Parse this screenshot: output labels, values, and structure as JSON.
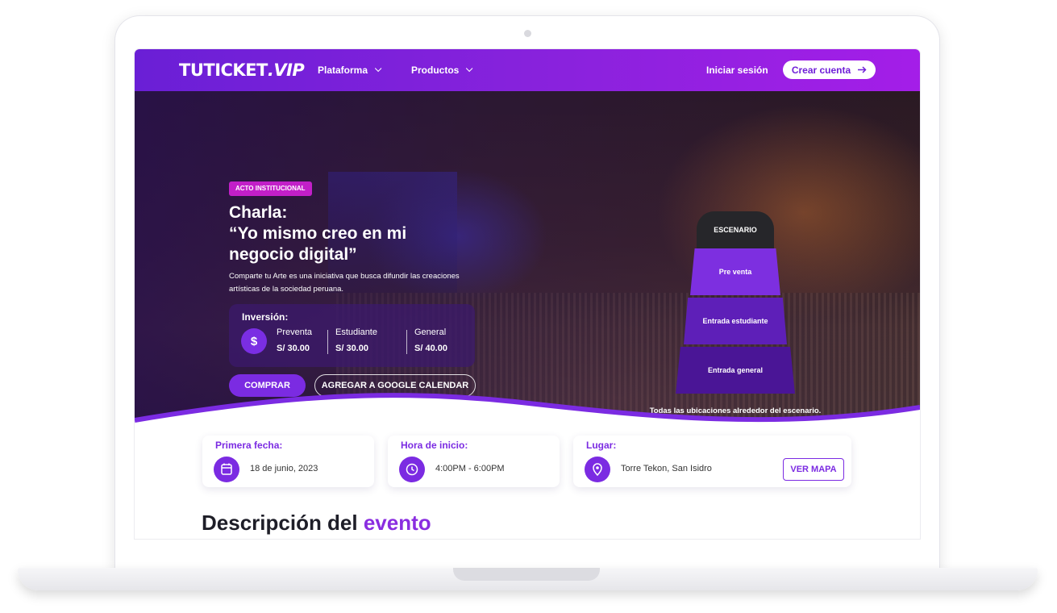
{
  "navbar": {
    "logo_main": "TUTICKET",
    "logo_suffix": ".VIP",
    "platform_label": "Plataforma",
    "products_label": "Productos",
    "login_label": "Iniciar sesión",
    "signup_label": "Crear cuenta"
  },
  "hero": {
    "badge": "ACTO INSTITUCIONAL",
    "title_line1": "Charla:",
    "title_line2": "“Yo mismo creo en mi",
    "title_line3": "negocio digital”",
    "description": "Comparte tu Arte es una iniciativa que busca difundir las creaciones artísticas de la sociedad peruana.",
    "investment": {
      "title": "Inversión:",
      "currency_symbol": "$",
      "prices": [
        {
          "label": "Preventa",
          "value": "S/ 30.00"
        },
        {
          "label": "Estudiante",
          "value": "S/ 30.00"
        },
        {
          "label": "General",
          "value": "S/ 40.00"
        }
      ]
    },
    "buy_label": "COMPRAR",
    "calendar_label": "AGREGAR A GOOGLE CALENDAR"
  },
  "seatmap": {
    "stage": "ESCENARIO",
    "zones": [
      "Pre venta",
      "Entrada estudiante",
      "Entrada general"
    ],
    "note": "Todas las ubicaciones alrededor del escenario."
  },
  "info": {
    "date": {
      "title": "Primera fecha:",
      "value": "18 de junio, 2023"
    },
    "time": {
      "title": "Hora de inicio:",
      "value": "4:00PM - 6:00PM"
    },
    "place": {
      "title": "Lugar:",
      "value": "Torre Tekon, San Isidro",
      "map_label": "VER MAPA"
    }
  },
  "description_section": {
    "title_main": "Descripción del ",
    "title_accent": "evento"
  },
  "colors": {
    "brand_purple": "#7b2be2",
    "badge_magenta": "#c21fc8",
    "stage_dark": "#26262a"
  }
}
